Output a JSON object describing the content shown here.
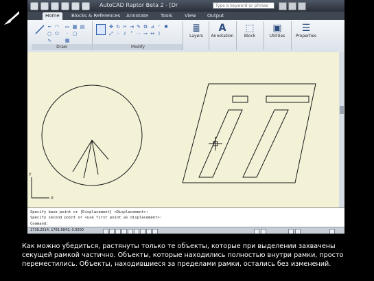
{
  "app_title": "AutoCAD Raptor Beta 2 - [Dr",
  "search_placeholder": "Type a keyword or phrase",
  "tabs": [
    "Home",
    "Blocks & References",
    "Annotate",
    "Tools",
    "View",
    "Output"
  ],
  "panels": {
    "draw": "Draw",
    "modify": "Modify",
    "layers": "Layers",
    "annotation": "Annotation",
    "block": "Block",
    "utilities": "Utilities",
    "properties": "Properties"
  },
  "command_history": [
    "Specify base point or [Displacement] <Displacement>:",
    "Specify second point or <use first point as displacement>:"
  ],
  "command_prompt": "Command:",
  "status_coords": "1738.2514, 1781.6843, 0.0000",
  "ucs": {
    "x": "X",
    "y": "Y"
  },
  "caption": "Как можно убедиться, растянуты только те объекты, которые при выделении захвачены секущей рамкой частично. Объекты, которые находились полностью внутри рамки, просто переместились. Объекты, находившиеся за пределами рамки, остались без изменений."
}
